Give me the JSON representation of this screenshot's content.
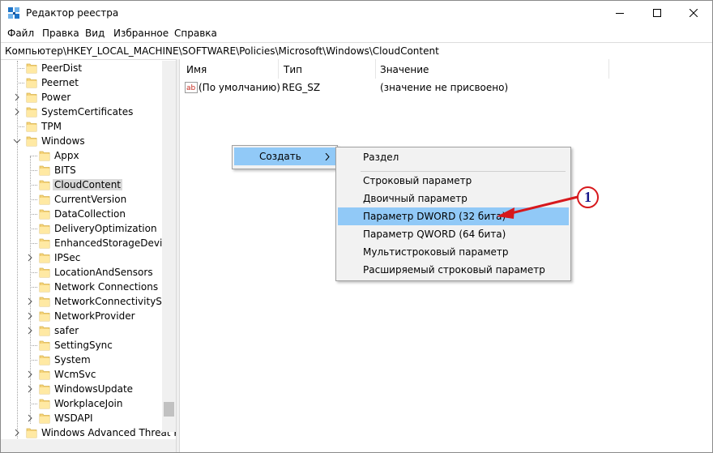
{
  "window": {
    "title": "Редактор реестра",
    "accent_color": "#91c9f7",
    "arrow_color": "#d7181c"
  },
  "menu": [
    "Файл",
    "Правка",
    "Вид",
    "Избранное",
    "Справка"
  ],
  "address": "Компьютер\\HKEY_LOCAL_MACHINE\\SOFTWARE\\Policies\\Microsoft\\Windows\\CloudContent",
  "tree": {
    "items": [
      {
        "label": "PeerDist",
        "chevron": "none"
      },
      {
        "label": "Peernet",
        "chevron": "none"
      },
      {
        "label": "Power",
        "chevron": "right"
      },
      {
        "label": "SystemCertificates",
        "chevron": "right"
      },
      {
        "label": "TPM",
        "chevron": "none"
      },
      {
        "label": "Windows",
        "chevron": "down"
      },
      {
        "label": "Appx",
        "chevron": "none"
      },
      {
        "label": "BITS",
        "chevron": "none"
      },
      {
        "label": "CloudContent",
        "chevron": "none",
        "selected": true
      },
      {
        "label": "CurrentVersion",
        "chevron": "none"
      },
      {
        "label": "DataCollection",
        "chevron": "none"
      },
      {
        "label": "DeliveryOptimization",
        "chevron": "none"
      },
      {
        "label": "EnhancedStorageDevices",
        "chevron": "none"
      },
      {
        "label": "IPSec",
        "chevron": "right"
      },
      {
        "label": "LocationAndSensors",
        "chevron": "none"
      },
      {
        "label": "Network Connections",
        "chevron": "none"
      },
      {
        "label": "NetworkConnectivityStat",
        "chevron": "right"
      },
      {
        "label": "NetworkProvider",
        "chevron": "right"
      },
      {
        "label": "safer",
        "chevron": "right"
      },
      {
        "label": "SettingSync",
        "chevron": "none"
      },
      {
        "label": "System",
        "chevron": "none"
      },
      {
        "label": "WcmSvc",
        "chevron": "right"
      },
      {
        "label": "WindowsUpdate",
        "chevron": "right"
      },
      {
        "label": "WorkplaceJoin",
        "chevron": "none"
      },
      {
        "label": "WSDAPI",
        "chevron": "right"
      },
      {
        "label": "Windows Advanced Threat P",
        "chevron": "right"
      }
    ]
  },
  "list": {
    "columns": [
      "Имя",
      "Тип",
      "Значение"
    ],
    "rows": [
      {
        "name": "(По умолчанию)",
        "type": "REG_SZ",
        "value": "(значение не присвоено)",
        "icon": "ab"
      }
    ]
  },
  "context_menu": {
    "create_label": "Создать"
  },
  "submenu": {
    "items": [
      "Раздел",
      "Строковый параметр",
      "Двоичный параметр",
      "Параметр DWORD (32 бита)",
      "Параметр QWORD (64 бита)",
      "Мультистроковый параметр",
      "Расширяемый строковый параметр"
    ]
  },
  "annotation": {
    "badge": "1"
  }
}
